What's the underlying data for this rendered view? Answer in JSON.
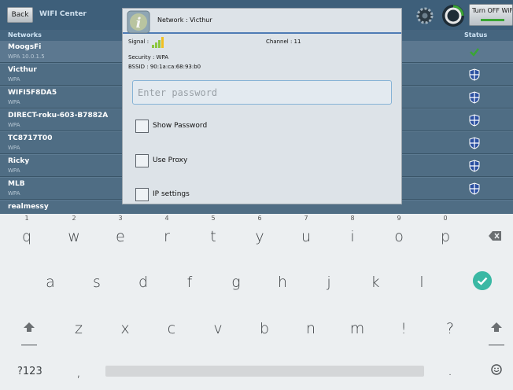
{
  "app": {
    "back_label": "Back",
    "title": "WIFI Center",
    "turnoff_label": "Turn OFF WiFi",
    "col_networks": "Networks",
    "col_status": "Status",
    "networks": [
      {
        "name": "MoogsFi",
        "sub": "WPA  10.0.1.5",
        "status": "connected"
      },
      {
        "name": "Victhur",
        "sub": "WPA",
        "status": "secured"
      },
      {
        "name": "WIFI5F8DA5",
        "sub": "WPA",
        "status": "secured"
      },
      {
        "name": "DIRECT-roku-603-B7882A",
        "sub": "WPA",
        "status": "secured"
      },
      {
        "name": "TC8717T00",
        "sub": "WPA",
        "status": "secured"
      },
      {
        "name": "Ricky",
        "sub": "WPA",
        "status": "secured"
      },
      {
        "name": "MLB",
        "sub": "WPA",
        "status": "secured"
      },
      {
        "name": "realmessy",
        "sub": "",
        "status": "secured"
      }
    ]
  },
  "dialog": {
    "title": "Network : Victhur",
    "signal_label": "Signal :",
    "channel_text": "Channel : 11",
    "security_text": "Security : WPA",
    "bssid_text": "BSSID : 90:1a:ca:68:93:b0",
    "password_placeholder": "Enter password",
    "show_password_label": "Show Password",
    "use_proxy_label": "Use Proxy",
    "ip_settings_label": "IP settings"
  },
  "keyboard": {
    "row1": [
      {
        "ch": "q",
        "hint": "1"
      },
      {
        "ch": "w",
        "hint": "2"
      },
      {
        "ch": "e",
        "hint": "3"
      },
      {
        "ch": "r",
        "hint": "4"
      },
      {
        "ch": "t",
        "hint": "5"
      },
      {
        "ch": "y",
        "hint": "6"
      },
      {
        "ch": "u",
        "hint": "7"
      },
      {
        "ch": "i",
        "hint": "8"
      },
      {
        "ch": "o",
        "hint": "9"
      },
      {
        "ch": "p",
        "hint": "0"
      }
    ],
    "row2": [
      "a",
      "s",
      "d",
      "f",
      "g",
      "h",
      "j",
      "k",
      "l"
    ],
    "row3": [
      "z",
      "x",
      "c",
      "v",
      "b",
      "n",
      "m",
      "!",
      "?"
    ],
    "symbols_label": "?123",
    "comma": ",",
    "period": ".",
    "icons": {
      "backspace": "backspace-icon",
      "enter": "checkmark-icon",
      "shift": "shift-icon",
      "emoji": "emoji-icon"
    },
    "accent_color": "#3ab8a4"
  }
}
